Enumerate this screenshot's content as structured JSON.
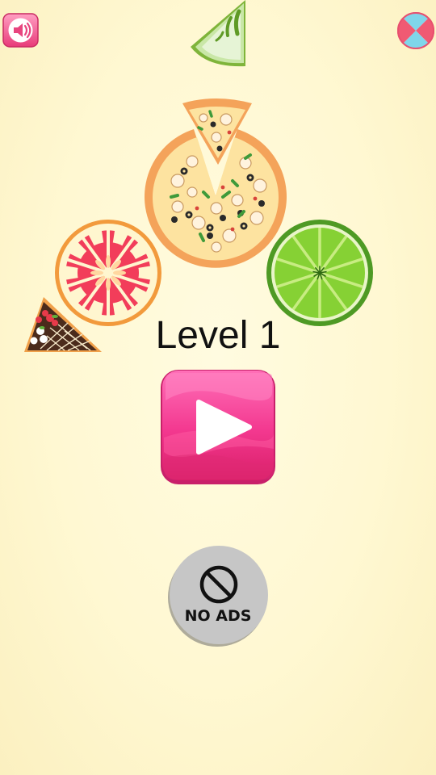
{
  "header": {
    "sound_icon": "speaker-icon",
    "close_icon": "close-icon"
  },
  "main": {
    "level_title": "Level 1",
    "play_icon": "play-icon"
  },
  "footer": {
    "no_ads_label": "NO ADS",
    "no_ads_icon": "prohibited-icon"
  },
  "colors": {
    "background": "#fff8d2",
    "play_button": "#f3388f",
    "sound_button": "#f5598f",
    "lime": "#7ac92a",
    "grapefruit": "#f23d5a",
    "no_ads_button": "#c4c4c4"
  }
}
